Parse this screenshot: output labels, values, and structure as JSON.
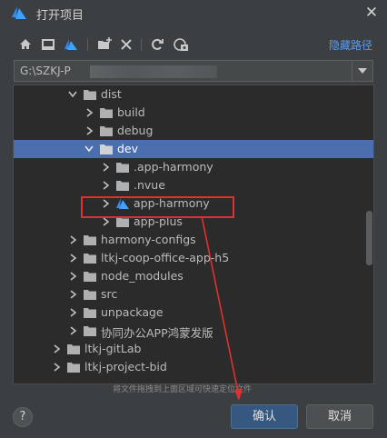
{
  "window": {
    "title": "打开项目",
    "close_glyph": "✕"
  },
  "toolbar": {
    "hide_path_label": "隐藏路径",
    "icons": [
      "home-icon",
      "desktop-icon",
      "project-icon",
      "new-folder-icon",
      "delete-icon",
      "refresh-icon",
      "show-hidden-icon"
    ]
  },
  "path": {
    "value": "G:\\SZKJ-P"
  },
  "tree": {
    "rows": [
      {
        "label": "dist",
        "expanded": true,
        "selected": false
      },
      {
        "label": "build",
        "expanded": false,
        "selected": false
      },
      {
        "label": "debug",
        "expanded": false,
        "selected": false
      },
      {
        "label": "dev",
        "expanded": true,
        "selected": true
      },
      {
        "label": ".app-harmony",
        "expanded": false,
        "selected": false
      },
      {
        "label": ".nvue",
        "expanded": false,
        "selected": false
      },
      {
        "label": "app-harmony",
        "expanded": false,
        "selected": false,
        "project_icon": true
      },
      {
        "label": "app-plus",
        "expanded": false,
        "selected": false
      },
      {
        "label": "harmony-configs",
        "expanded": false,
        "selected": false
      },
      {
        "label": "ltkj-coop-office-app-h5",
        "expanded": false,
        "selected": false
      },
      {
        "label": "node_modules",
        "expanded": false,
        "selected": false
      },
      {
        "label": "src",
        "expanded": false,
        "selected": false
      },
      {
        "label": "unpackage",
        "expanded": false,
        "selected": false
      },
      {
        "label": "协同办公APP鸿蒙发版",
        "expanded": false,
        "selected": false
      },
      {
        "label": "ltkj-gitLab",
        "expanded": false,
        "selected": false
      },
      {
        "label": "ltkj-project-bid",
        "expanded": false,
        "selected": false
      }
    ]
  },
  "hint": "将文件拖拽到上面区域可快速定位文件",
  "buttons": {
    "help": "?",
    "ok": "确认",
    "cancel": "取消"
  },
  "colors": {
    "accent": "#589df6",
    "selection": "#4b6eaf",
    "annotation": "#e0312f"
  }
}
